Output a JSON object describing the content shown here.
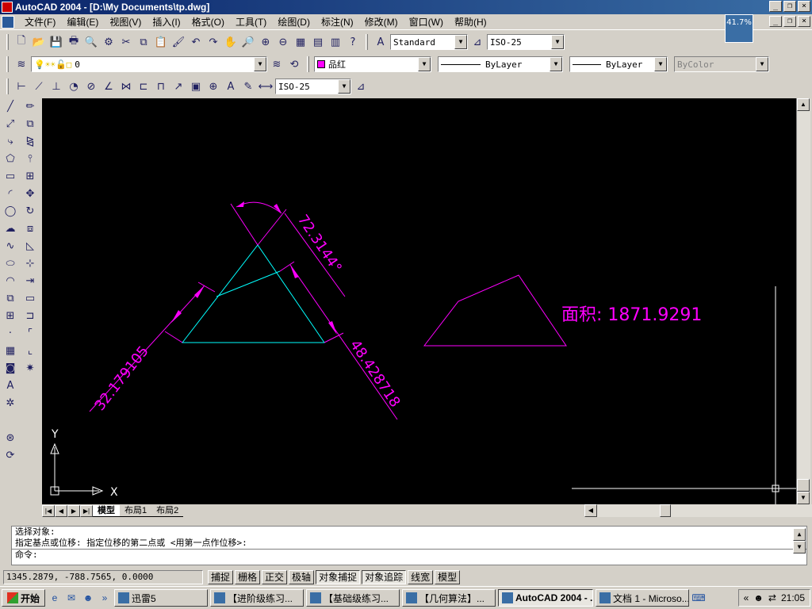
{
  "window": {
    "title": "AutoCAD 2004 - [D:\\My Documents\\tp.dwg]"
  },
  "zoom_badge": "41.7%",
  "menu": [
    "文件(F)",
    "编辑(E)",
    "视图(V)",
    "插入(I)",
    "格式(O)",
    "工具(T)",
    "绘图(D)",
    "标注(N)",
    "修改(M)",
    "窗口(W)",
    "帮助(H)"
  ],
  "styles": {
    "text_style": "Standard",
    "dim_style": "ISO-25"
  },
  "layers": {
    "current": "0",
    "color": "品红",
    "linetype": "ByLayer",
    "lineweight": "ByLayer",
    "plotstyle": "ByColor"
  },
  "dim_toolbar": {
    "dim_style": "ISO-25"
  },
  "drawing": {
    "dim_angle": "72.3144°",
    "dim_left": "32.179105",
    "dim_right": "48.428718",
    "area_label": "面积:  1871.9291",
    "ucs_x": "X",
    "ucs_y": "Y"
  },
  "colors": {
    "canvas": "#000000",
    "magenta": "#ff00ff",
    "cyan": "#00ffff",
    "crosshair": "#ffffff"
  },
  "layout_tabs": [
    "模型",
    "布局1",
    "布局2"
  ],
  "command": {
    "line1": "选择对象:",
    "line2": "指定基点或位移: 指定位移的第二点或 <用第一点作位移>:",
    "prompt": "命令:"
  },
  "status": {
    "coords": "1345.2879, -788.7565, 0.0000",
    "buttons": [
      "捕捉",
      "栅格",
      "正交",
      "极轴",
      "对象捕捉",
      "对象追踪",
      "线宽",
      "模型"
    ]
  },
  "taskbar": {
    "start": "开始",
    "items": [
      "迅雷5",
      "【进阶级练习...",
      "【基础级练习...",
      "【几何算法】...",
      "AutoCAD 2004 - ...",
      "文档 1 - Microso..."
    ],
    "clock": "21:05"
  }
}
